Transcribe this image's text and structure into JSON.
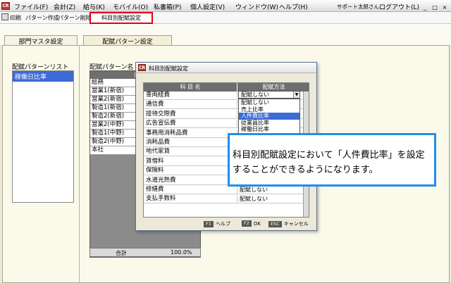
{
  "app": {
    "icon_text": "CR"
  },
  "menu": {
    "items": [
      "ファイル(F)",
      "会計(Z)",
      "給与(K)",
      "モバイル(O)",
      "私書箱(P)",
      "個人設定(V)",
      "ウィンドウ(W)",
      "ヘルプ(H)"
    ],
    "user": "サポート太郎さん",
    "logout": "ログアウト(L)",
    "win_min": "_",
    "win_max": "□",
    "win_close": "×"
  },
  "toolbar": {
    "print": "印刷",
    "create_pattern": "パターン作成",
    "delete_pattern": "パターン削除",
    "subject_setting": "科目別配賦設定"
  },
  "tabs": [
    "部門マスタ設定",
    "配賦パターン設定"
  ],
  "left": {
    "list_title": "配賦パターンリスト",
    "selected_pattern": "稼働日比率",
    "grid_title": "配賦パターン名",
    "grid_header": "損益部門",
    "dept_rows": [
      "総務",
      "営業1(新宿)",
      "営業2(新宿)",
      "製造1(新宿)",
      "製造2(新宿)",
      "営業2(中野)",
      "製造1(中野)",
      "製造2(中野)",
      "本社"
    ],
    "total_label": "合計",
    "total_value": "100.0%"
  },
  "dialog": {
    "title": "科目別配賦設定",
    "col_subject": "科 目 名",
    "col_method": "配賦方法",
    "rows": [
      {
        "name": "車両経費",
        "value": ""
      },
      {
        "name": "通信費",
        "value": ""
      },
      {
        "name": "接待交際費",
        "value": ""
      },
      {
        "name": "広告宣伝費",
        "value": ""
      },
      {
        "name": "事務用消耗品費",
        "value": ""
      },
      {
        "name": "消耗品費",
        "value": ""
      },
      {
        "name": "地代家賃",
        "value": ""
      },
      {
        "name": "賃借料",
        "value": ""
      },
      {
        "name": "保険料",
        "value": ""
      },
      {
        "name": "水道光熱費",
        "value": ""
      },
      {
        "name": "修繕費",
        "value": "配賦しない"
      },
      {
        "name": "支払手数料",
        "value": "配賦しない"
      }
    ],
    "dropdown_value": "配賦しない",
    "dropdown_options": [
      "配賦しない",
      "売上比率",
      "人件費比率",
      "従業員比率",
      "稼働日比率"
    ],
    "dropdown_selected_index": 2,
    "footer": {
      "help_key": "F1",
      "help_label": "ヘルプ",
      "ok_key": "F2",
      "ok_label": "OK",
      "cancel_key": "ESC",
      "cancel_label": "キャンセル"
    }
  },
  "callout": {
    "text": "科目別配賦設定において「人件費比率」を設定することができるようになります。"
  },
  "colors": {
    "highlight": "#e0001a",
    "callout_border": "#1d8ff0",
    "selection": "#3a6bd6"
  }
}
